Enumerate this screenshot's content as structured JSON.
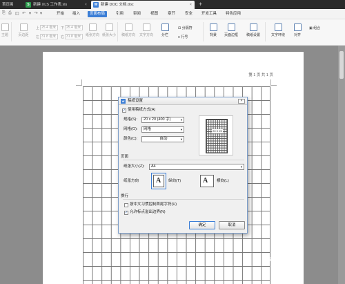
{
  "tabs": [
    {
      "label": "首页画",
      "icon": ""
    },
    {
      "label": "新建 XLS 工作表.xls",
      "icon": "S"
    },
    {
      "label": "新建 DOC 文档.doc",
      "icon": "W"
    }
  ],
  "menu": {
    "start": "开始",
    "items": [
      "插入",
      "页面布局",
      "引用",
      "审阅",
      "视图",
      "章节",
      "安全",
      "开发工具",
      "特色应用"
    ]
  },
  "ribbon": {
    "left_labels": [
      "主题",
      "页边距",
      "纸张方向",
      "纸张大小"
    ],
    "margin_top": "25.4 毫米",
    "margin_bottom": "25.4 毫米",
    "margin_left": "31.8 毫米",
    "margin_right": "31.8 毫米",
    "mid_labels": [
      "稿纸方向",
      "文字方向"
    ],
    "fenlan": "分栏",
    "fenge": "分隔符",
    "hanghao": "行号",
    "beijing": "背景",
    "yemian_bianku": "页面边框",
    "gaozhi_shezhi": "稿纸设置",
    "wenzi_huanrao": "文字环绕",
    "duiqi": "对齐",
    "zuhe": "组合"
  },
  "page": {
    "page_indicator": "第 1 页 共 1 页"
  },
  "dialog": {
    "title": "稿纸设置",
    "close": "×",
    "use_manuscript_label": "使用稿纸方式(A)",
    "spec_label": "规格(S):",
    "spec_value": "20 x 20 (400 字)",
    "grid_label": "网格(G):",
    "grid_value": "网格",
    "color_label": "颜色(C):",
    "color_value": "自动",
    "preview_text": "20 X 20",
    "page_section": "页面",
    "paper_size_label": "纸张大小(Z):",
    "paper_size_value": "A4",
    "paper_orient_label": "纸张方向",
    "portrait_label": "纵向(T)",
    "landscape_label": "横向(L)",
    "orient_glyph": "A",
    "wrap_section": "换行",
    "opt1_label": "按中文习惯控制首尾字符(U)",
    "opt2_label": "允许标点溢出边界(N)",
    "ok": "确定",
    "cancel": "取消",
    "check_glyph": "✓",
    "dropdown_glyph": "▼"
  },
  "watermark": "Baidu 经验",
  "colors": {
    "accent": "#3b7ed6",
    "tabbar": "#2b2b2b",
    "workspace": "#8c8c8c"
  }
}
